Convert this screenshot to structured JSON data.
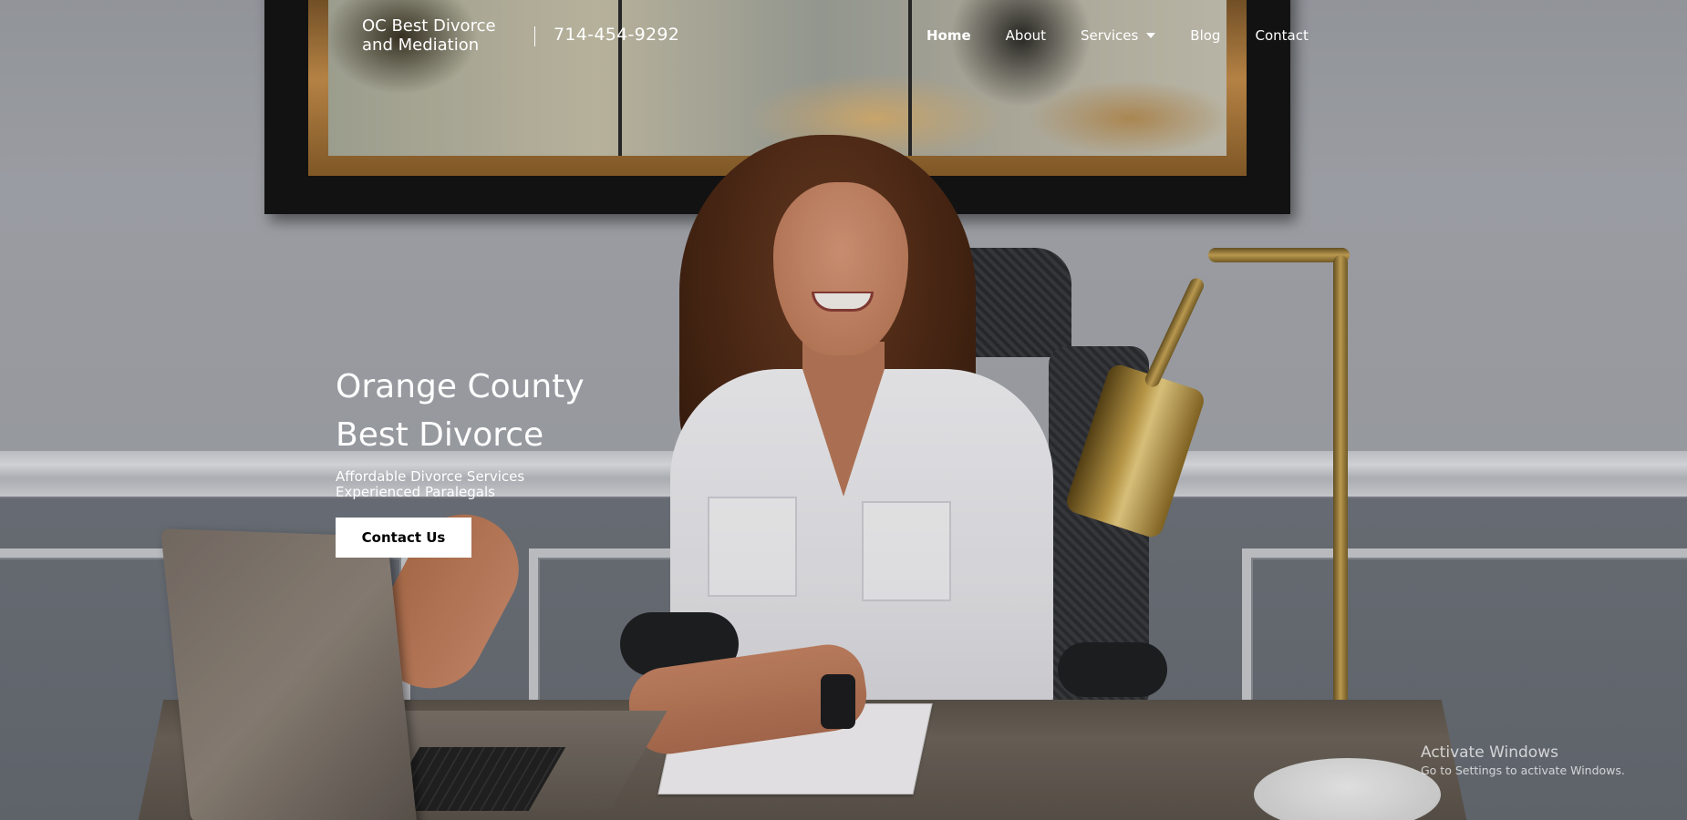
{
  "header": {
    "brand_line1": "OC Best Divorce",
    "brand_line2": "and Mediation",
    "phone": "714-454-9292",
    "nav": [
      {
        "label": "Home",
        "active": true
      },
      {
        "label": "About",
        "active": false
      },
      {
        "label": "Services",
        "active": false,
        "has_dropdown": true
      },
      {
        "label": "Blog",
        "active": false
      },
      {
        "label": "Contact",
        "active": false
      }
    ]
  },
  "hero": {
    "title_line1": "Orange County",
    "title_line2": "Best Divorce",
    "subtitle_line1": "Affordable Divorce Services",
    "subtitle_line2": "Experienced Paralegals",
    "cta_label": "Contact Us"
  },
  "watermark": {
    "title": "Activate Windows",
    "subtitle": "Go to Settings to activate Windows."
  },
  "colors": {
    "nav_text": "#ffffff",
    "cta_background": "#ffffff",
    "cta_text": "#000000"
  },
  "icons": {
    "services_dropdown": "caret-down-icon"
  }
}
